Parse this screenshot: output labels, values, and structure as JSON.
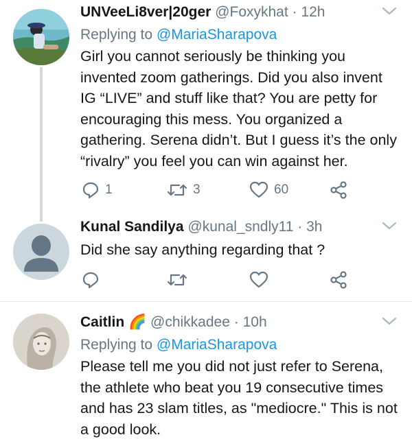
{
  "tweets": [
    {
      "name": "UNVeeLi8ver|20ger",
      "handle": "@Foxykhat",
      "time": "12h",
      "reply_prefix": "Replying to",
      "reply_mention": "@MariaSharapova",
      "text": "Girl you cannot seriously be thinking you invented zoom gatherings. Did you also invent IG “LIVE” and stuff like that? You are petty for encouraging this mess. You organized a gathering. Serena didn’t. But I guess it’s the only “rivalry” you feel you can win against her.",
      "replies": "1",
      "retweets": "3",
      "likes": "60"
    },
    {
      "name": "Kunal Sandilya",
      "handle": "@kunal_sndly11",
      "time": "3h",
      "text": "Did she say anything regarding that ?",
      "replies": "",
      "retweets": "",
      "likes": ""
    },
    {
      "name": "Caitlin",
      "name_emoji": "🌈",
      "handle": "@chikkadee",
      "time": "10h",
      "reply_prefix": "Replying to",
      "reply_mention": "@MariaSharapova",
      "text": "Please tell me you did not just refer to Serena, the athlete who beat you 19 consecutive times and has 23 slam titles, as \"mediocre.\" This is not a good look."
    }
  ],
  "separator": "·",
  "colors": {
    "text": "#14171a",
    "meta": "#657786",
    "link": "#1b95e0",
    "thread": "#cfd9de"
  }
}
